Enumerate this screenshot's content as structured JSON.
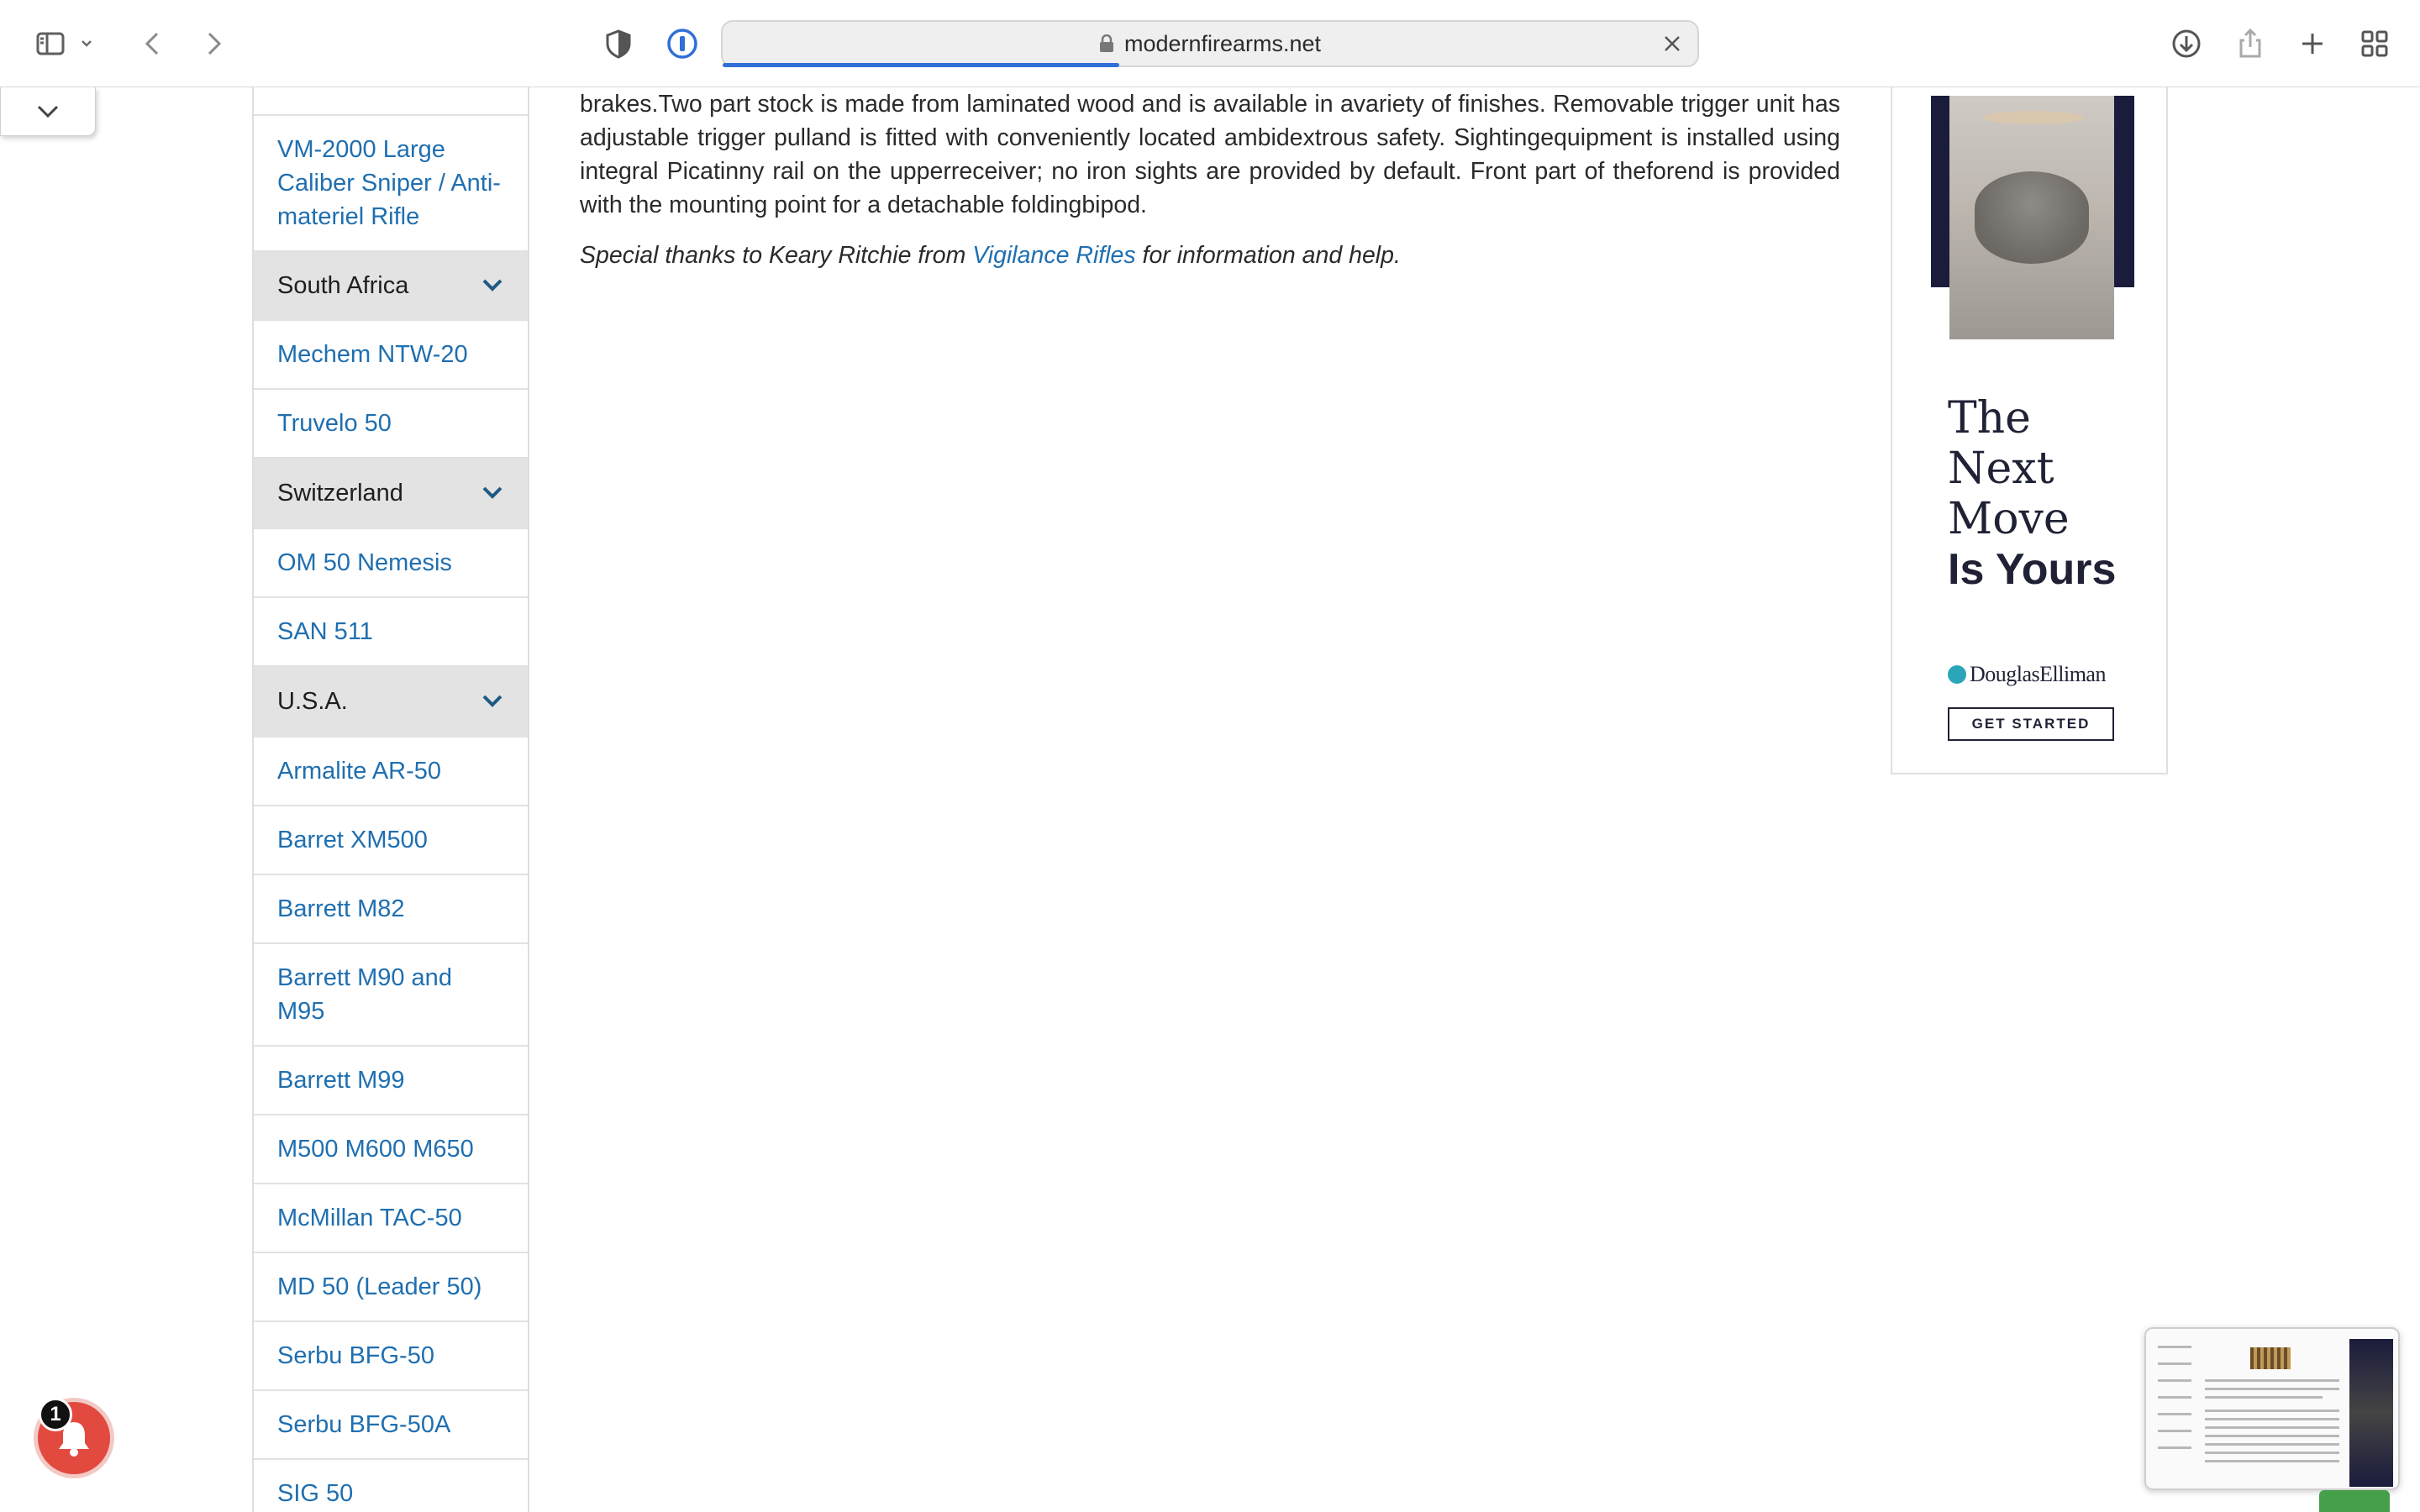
{
  "browser": {
    "url": "modernfirearms.net"
  },
  "sidebar": {
    "items": [
      {
        "label": "",
        "type": "link"
      },
      {
        "label": "VM-2000 Large Caliber Sniper / Anti-materiel Rifle",
        "type": "link"
      },
      {
        "label": "South Africa",
        "type": "country"
      },
      {
        "label": "Mechem NTW-20",
        "type": "link"
      },
      {
        "label": "Truvelo 50",
        "type": "link"
      },
      {
        "label": "Switzerland",
        "type": "country"
      },
      {
        "label": "OM 50 Nemesis",
        "type": "link"
      },
      {
        "label": "SAN 511",
        "type": "link"
      },
      {
        "label": "U.S.A.",
        "type": "country"
      },
      {
        "label": "Armalite AR-50",
        "type": "link"
      },
      {
        "label": "Barret XM500",
        "type": "link"
      },
      {
        "label": "Barrett M82",
        "type": "link"
      },
      {
        "label": "Barrett M90 and M95",
        "type": "link"
      },
      {
        "label": "Barrett M99",
        "type": "link"
      },
      {
        "label": "M500 M600 M650",
        "type": "link"
      },
      {
        "label": "McMillan TAC-50",
        "type": "link"
      },
      {
        "label": "MD 50 (Leader 50)",
        "type": "link"
      },
      {
        "label": "Serbu BFG-50",
        "type": "link"
      },
      {
        "label": "Serbu BFG-50A",
        "type": "link"
      },
      {
        "label": "SIG 50",
        "type": "link"
      }
    ]
  },
  "article": {
    "paragraph": "brakes.Two part stock is made from laminated wood and is available in avariety of finishes. Removable trigger unit has adjustable trigger pulland is fitted with conveniently located ambidextrous safety. Sightingequipment is installed using integral Picatinny rail on the upperreceiver; no iron sights are provided by default. Front part of theforend is provided with the mounting point for a detachable foldingbipod.",
    "thanks_prefix": "Special thanks to Keary Ritchie from ",
    "thanks_link": "Vigilance Rifles",
    "thanks_suffix": " for information and help."
  },
  "ad": {
    "headline_lines": [
      "The",
      "Next",
      "Move"
    ],
    "headline_bold": "Is Yours",
    "brand": "DouglasElliman",
    "cta": "GET STARTED"
  },
  "notifications": {
    "count": "1"
  },
  "colors": {
    "link": "#1f6fb0",
    "country_bg": "#e3e3e3",
    "bell": "#e24a3f",
    "accent": "#2f6fd6"
  }
}
